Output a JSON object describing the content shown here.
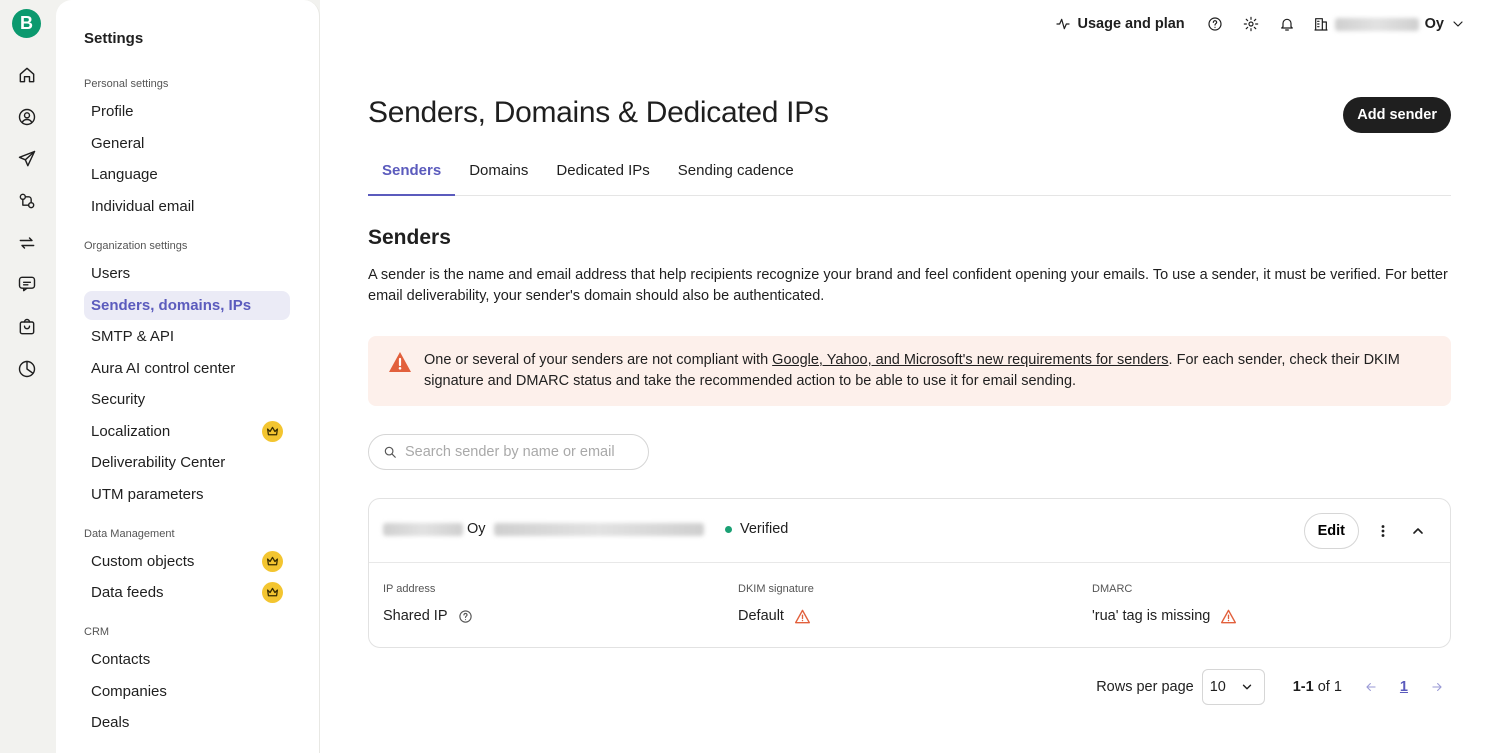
{
  "rail": {
    "logo_letter": "B",
    "icons": [
      "home-icon",
      "contacts-icon",
      "campaigns-icon",
      "automations-icon",
      "transactional-icon",
      "conversations-icon",
      "sales-icon",
      "reports-icon"
    ]
  },
  "sidebar": {
    "title": "Settings",
    "sections": [
      {
        "label": "Personal settings",
        "items": [
          "Profile",
          "General",
          "Language",
          "Individual email"
        ]
      },
      {
        "label": "Organization settings",
        "items": [
          "Users",
          "Senders, domains, IPs",
          "SMTP & API",
          "Aura AI control center",
          "Security",
          "Localization",
          "Deliverability Center",
          "UTM parameters"
        ]
      },
      {
        "label": "Data Management",
        "items": [
          "Custom objects",
          "Data feeds"
        ]
      },
      {
        "label": "CRM",
        "items": [
          "Contacts",
          "Companies",
          "Deals"
        ]
      }
    ],
    "active_item": "Senders, domains, IPs",
    "premium_items": [
      "Localization",
      "Custom objects",
      "Data feeds"
    ]
  },
  "topbar": {
    "usage_label": "Usage and plan",
    "org_suffix": "Oy"
  },
  "page": {
    "title": "Senders, Domains & Dedicated IPs",
    "add_button": "Add sender",
    "tabs": [
      "Senders",
      "Domains",
      "Dedicated IPs",
      "Sending cadence"
    ],
    "active_tab": "Senders",
    "section_title": "Senders",
    "description": "A sender is the name and email address that help recipients recognize your brand and feel confident opening your emails. To use a sender, it must be verified. For better email deliverability, your sender's domain should also be authenticated.",
    "alert": {
      "before": "One or several of your senders are not compliant with ",
      "link": "Google, Yahoo, and Microsoft's new requirements for senders",
      "after": ". For each sender, check their DKIM signature and DMARC status and take the recommended action to be able to use it for email sending."
    },
    "search_placeholder": "Search sender by name or email"
  },
  "sender": {
    "name_suffix": "Oy",
    "status": "Verified",
    "edit_label": "Edit",
    "ip_label": "IP address",
    "ip_value": "Shared IP",
    "dkim_label": "DKIM signature",
    "dkim_value": "Default",
    "dmarc_label": "DMARC",
    "dmarc_value": "'rua' tag is missing"
  },
  "pagination": {
    "rows_label": "Rows per page",
    "rows_value": "10",
    "range_bold": "1-1",
    "range_rest": "of 1",
    "current_page": "1"
  },
  "colors": {
    "accent": "#5b5bbd",
    "brand": "#0b996e",
    "verified": "#1aa074",
    "warning": "#e2603c",
    "premium": "#f3c530"
  }
}
